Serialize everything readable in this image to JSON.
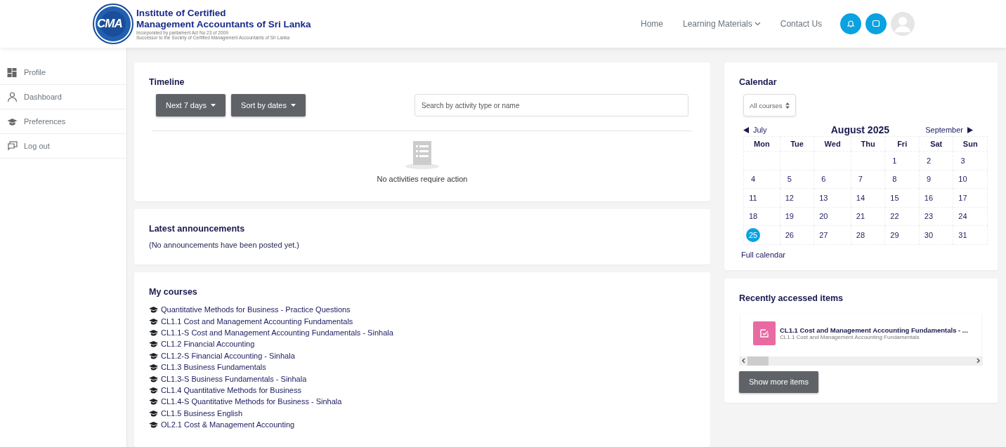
{
  "header": {
    "logo_mark": "CMA",
    "org_name_line1": "Institute of Certified",
    "org_name_line2": "Management Accountants of Sri Lanka",
    "org_note_line1": "Incorporated by parliament Act No 23 of 2009",
    "org_note_line2": "Successor to the Society of Certified Management Accountants of Sri Lanka",
    "nav": [
      {
        "label": "Home",
        "dropdown": false
      },
      {
        "label": "Learning Materials",
        "dropdown": true
      },
      {
        "label": "Contact Us",
        "dropdown": false
      }
    ]
  },
  "sidebar": {
    "items": [
      {
        "label": "Profile",
        "kind": "grid"
      },
      {
        "label": "Dashboard",
        "kind": "person"
      },
      {
        "label": "Preferences",
        "kind": "cap"
      },
      {
        "label": "Log out",
        "kind": "chat"
      }
    ]
  },
  "timeline": {
    "title": "Timeline",
    "filters": [
      "Next 7 days",
      "Sort by dates"
    ],
    "search": {
      "placeholder": "Search by activity type or name"
    },
    "empty_message": "No activities require action"
  },
  "announcements": {
    "title": "Latest announcements",
    "message": "(No announcements have been posted yet.)"
  },
  "courses": {
    "title": "My courses",
    "items": [
      "Quantitative Methods for Business - Practice Questions",
      "CL1.1 Cost and Management Accounting Fundamentals",
      "CL1.1-S Cost and Management Accounting Fundamentals - Sinhala",
      "CL1.2 Financial Accounting",
      "CL1.2-S Financial Accounting - Sinhala",
      "CL1.3 Business Fundamentals",
      "CL1.3-S Business Fundamentals - Sinhala",
      "CL1.4 Quantitative Methods for Business",
      "CL1.4-S Quantitative Methods for Business - Sinhala",
      "CL1.5 Business English",
      "OL2.1 Cost & Management Accounting"
    ]
  },
  "calendar": {
    "title": "Calendar",
    "course_filter": "All courses",
    "prev_month": "July",
    "month": "August 2025",
    "next_month": "September",
    "weekdays": [
      "Mon",
      "Tue",
      "Wed",
      "Thu",
      "Fri",
      "Sat",
      "Sun"
    ],
    "weeks": [
      [
        {
          "day": "1",
          "selected": false
        },
        {
          "day": "2",
          "selected": false
        },
        {
          "day": "3",
          "selected": false
        }
      ],
      [
        {
          "day": "4",
          "selected": false
        },
        {
          "day": "5",
          "selected": false
        },
        {
          "day": "6",
          "selected": false
        },
        {
          "day": "7",
          "selected": false
        },
        {
          "day": "8",
          "selected": false
        },
        {
          "day": "9",
          "selected": false
        },
        {
          "day": "10",
          "selected": false
        }
      ],
      [
        {
          "day": "11",
          "selected": false
        },
        {
          "day": "12",
          "selected": false
        },
        {
          "day": "13",
          "selected": false
        },
        {
          "day": "14",
          "selected": false
        },
        {
          "day": "15",
          "selected": false
        },
        {
          "day": "16",
          "selected": false
        },
        {
          "day": "17",
          "selected": false
        }
      ],
      [
        {
          "day": "18",
          "selected": false
        },
        {
          "day": "19",
          "selected": false
        },
        {
          "day": "20",
          "selected": false
        },
        {
          "day": "21",
          "selected": false
        },
        {
          "day": "22",
          "selected": false
        },
        {
          "day": "23",
          "selected": false
        },
        {
          "day": "24",
          "selected": false
        }
      ],
      [
        {
          "day": "25",
          "selected": true
        },
        {
          "day": "26",
          "selected": false
        },
        {
          "day": "27",
          "selected": false
        },
        {
          "day": "28",
          "selected": false
        },
        {
          "day": "29",
          "selected": false
        },
        {
          "day": "30",
          "selected": false
        },
        {
          "day": "31",
          "selected": false
        }
      ]
    ],
    "full_link": "Full calendar"
  },
  "recent": {
    "title": "Recently accessed items",
    "items": [
      {
        "title": "CL1.1 Cost and Management Accounting Fundamentals - ...",
        "course": "CL1.1 Cost and Management Accounting Fundamentals"
      }
    ],
    "show_more": "Show more items"
  }
}
